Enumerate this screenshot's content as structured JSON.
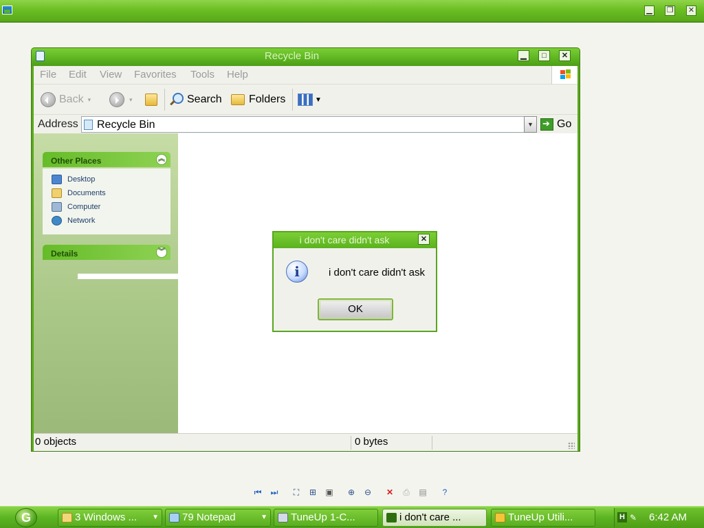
{
  "outer_window": {
    "icons": {
      "app": "image-viewer-icon",
      "minimize": "minimize-icon",
      "restore": "restore-icon",
      "close": "close-icon"
    }
  },
  "explorer": {
    "title": "Recycle Bin",
    "menu": [
      "File",
      "Edit",
      "View",
      "Favorites",
      "Tools",
      "Help"
    ],
    "toolbar": {
      "back": "Back",
      "search": "Search",
      "folders": "Folders"
    },
    "address": {
      "label": "Address",
      "value": "Recycle Bin",
      "go": "Go"
    },
    "other_places": {
      "heading": "Other Places",
      "items": [
        "Desktop",
        "Documents",
        "Computer",
        "Network"
      ]
    },
    "details": {
      "heading": "Details"
    },
    "status": {
      "objects": "0 objects",
      "size": "0 bytes"
    }
  },
  "dialog": {
    "title": "i don't care didn't ask",
    "message": "i don't care didn't ask",
    "ok": "OK"
  },
  "taskbar": {
    "tasks": [
      {
        "label": "3 Windows ...",
        "group": true
      },
      {
        "label": "79 Notepad",
        "group": true
      },
      {
        "label": "TuneUp 1-C...",
        "group": false
      },
      {
        "label": "i don't care ...",
        "group": false,
        "active": true
      },
      {
        "label": "TuneUp Utili...",
        "group": false
      }
    ],
    "clock": "6:42 AM"
  },
  "colors": {
    "theme_green": "#5eb623",
    "title_text": "#d9f2bd",
    "desktop_bg": "#f4f4ee"
  }
}
